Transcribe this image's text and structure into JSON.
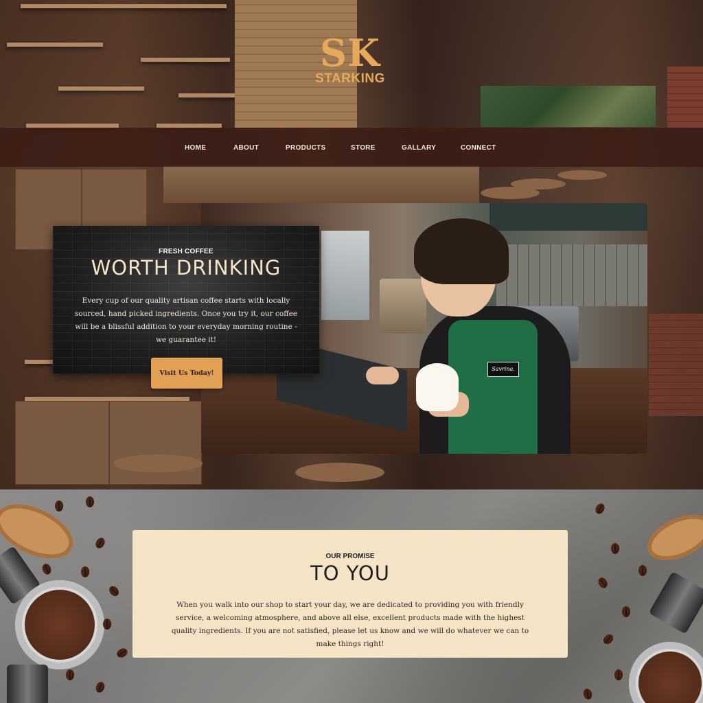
{
  "brand": {
    "mark": "SK",
    "name": "STARKING",
    "color": "#e6a85a"
  },
  "nav": {
    "items": [
      {
        "label": "HOME"
      },
      {
        "label": "ABOUT"
      },
      {
        "label": "PRODUCTS"
      },
      {
        "label": "STORE"
      },
      {
        "label": "GALLARY"
      },
      {
        "label": "CONNECT"
      }
    ]
  },
  "hero": {
    "kicker": "FRESH COFFEE",
    "title": "WORTH DRINKING",
    "body": "Every cup of our quality artisan coffee starts with locally sourced, hand picked ingredients. Once you try it, our coffee will be a blissful addition to your everyday morning routine - we guarantee it!",
    "button_label": "Visit Us Today!",
    "button_color": "#e3a155",
    "photo_name_tag": "Savrina."
  },
  "promise": {
    "kicker": "OUR PROMISE",
    "title": "TO YOU",
    "body": "When you walk into our shop to start your day, we are dedicated to providing you with friendly service, a welcoming atmosphere, and above all else, excellent products made with the highest quality ingredients. If you are not satisfied, please let us know and we will do whatever we can to make things right!",
    "card_color": "#f6e4c7"
  }
}
